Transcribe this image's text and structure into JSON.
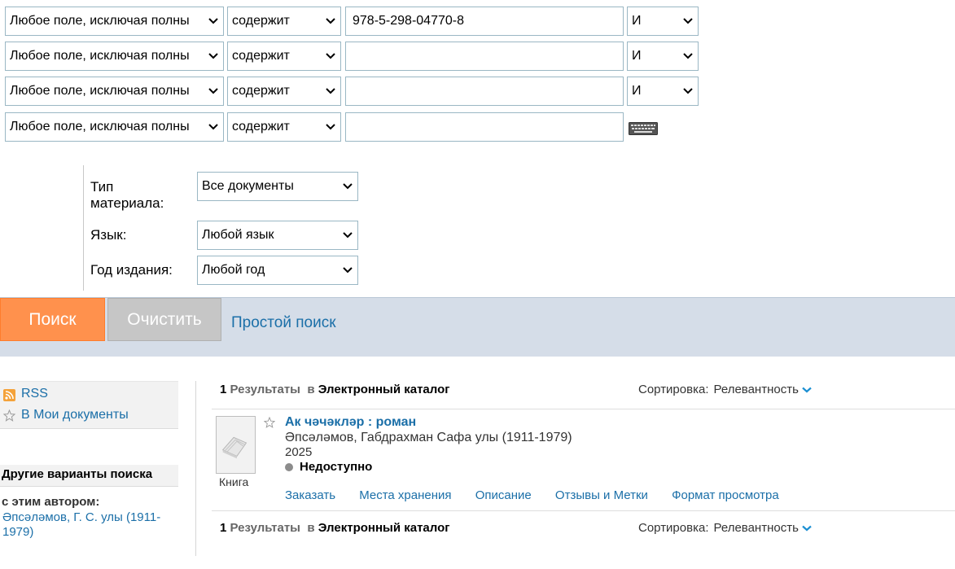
{
  "rows": [
    {
      "field": "Любое поле, исключая полны",
      "operator": "содержит",
      "value": "978-5-298-04770-8",
      "bool": "И"
    },
    {
      "field": "Любое поле, исключая полны",
      "operator": "содержит",
      "value": "",
      "bool": "И"
    },
    {
      "field": "Любое поле, исключая полны",
      "operator": "содержит",
      "value": "",
      "bool": "И"
    },
    {
      "field": "Любое поле, исключая полны",
      "operator": "содержит",
      "value": ""
    }
  ],
  "limits": {
    "type_label": "Тип материала:",
    "type_value": "Все документы",
    "lang_label": "Язык:",
    "lang_value": "Любой язык",
    "year_label": "Год издания:",
    "year_value": "Любой год"
  },
  "actions": {
    "search": "Поиск",
    "clear": "Очистить",
    "simple": "Простой поиск"
  },
  "sidebar": {
    "rss": "RSS",
    "mydocs": "В Мои документы",
    "other_title": "Другие варианты поиска",
    "author_label": "с этим автором:",
    "author_link": "Әпсәләмов, Г. С. улы (1911-1979)"
  },
  "results": {
    "count": "1",
    "results_word": "Результаты",
    "in_word": "в",
    "catalog": "Электронный каталог",
    "sort_label": "Сортировка:",
    "sort_value": "Релевантность"
  },
  "item": {
    "title": "Ак чәчәкләр : роман",
    "author": "Әпсәләмов, Габдрахман Сафа улы (1911-1979)",
    "year": "2025",
    "status": "Недоступно",
    "format": "Книга",
    "links": [
      "Заказать",
      "Места хранения",
      "Описание",
      "Отзывы и Метки",
      "Формат просмотра"
    ]
  },
  "colors": {
    "search_btn": "#ff914d",
    "clear_btn": "#c6c6c6",
    "link": "#1b6fa8",
    "bar": "#d5dde8"
  }
}
